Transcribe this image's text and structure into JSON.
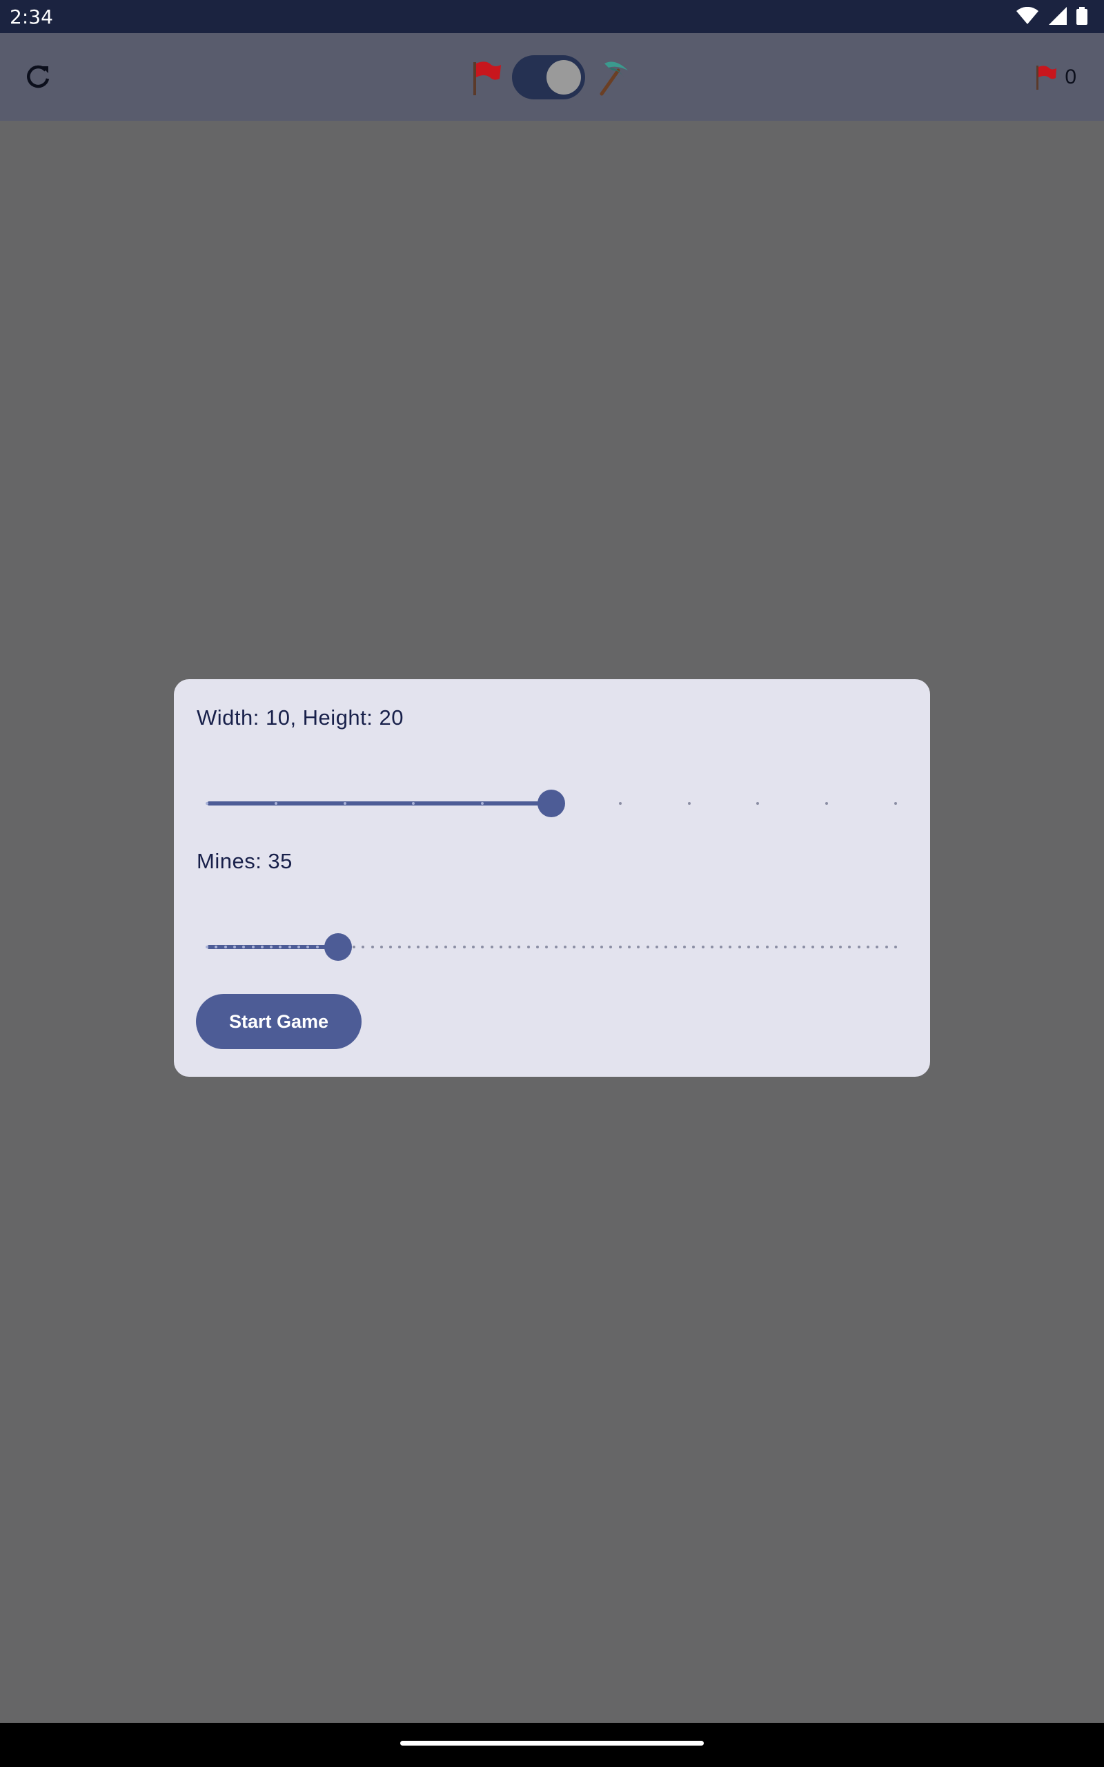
{
  "status_bar": {
    "time": "2:34"
  },
  "app_bar": {
    "mode_toggle": {
      "left_icon": "flag-icon",
      "right_icon": "pickaxe-icon",
      "state": "dig"
    },
    "flag_count": "0"
  },
  "dialog": {
    "size_label": "Width: 10, Height: 20",
    "size_slider": {
      "value": 5,
      "steps": 10
    },
    "mines_label": "Mines: 35",
    "mines_slider": {
      "fraction": 0.19,
      "steps": 75
    },
    "start_button": "Start Game"
  },
  "colors": {
    "accent": "#4d5c96",
    "dialog_bg": "#e3e3ee",
    "scrim": "#666667",
    "status_bar": "#1b2340"
  }
}
